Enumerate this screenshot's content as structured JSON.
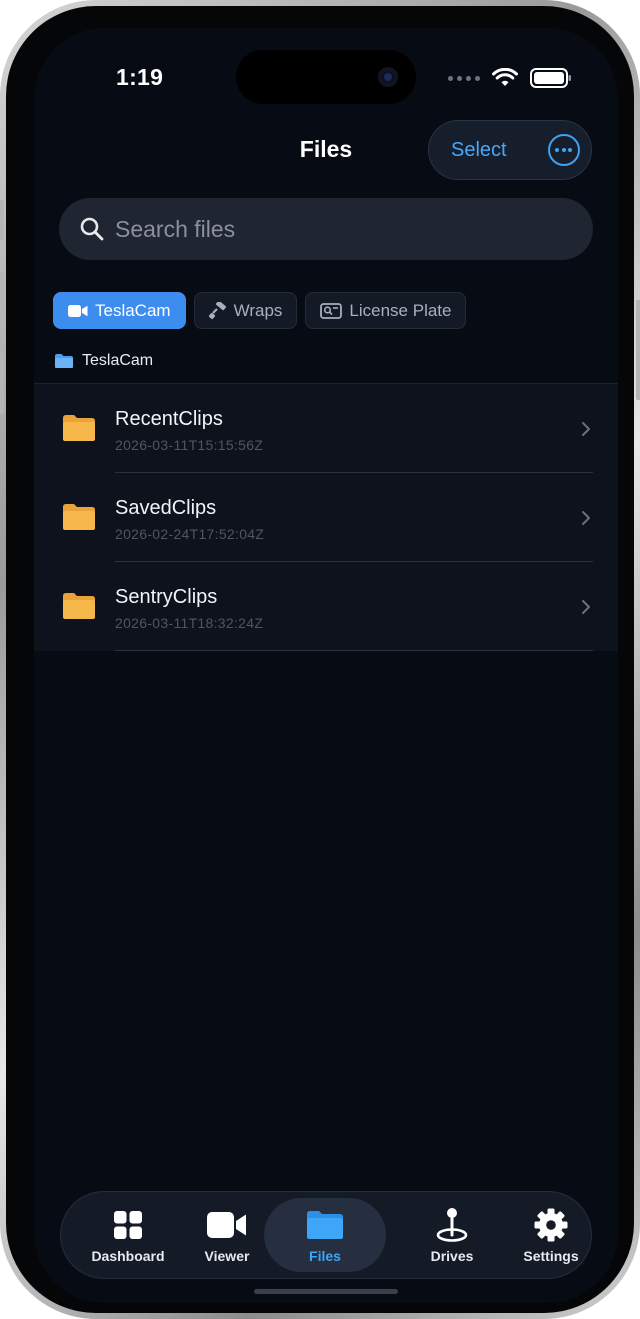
{
  "status": {
    "time": "1:19"
  },
  "nav": {
    "title": "Files",
    "select_label": "Select"
  },
  "search": {
    "placeholder": "Search files"
  },
  "chips": [
    {
      "label": "TeslaCam",
      "icon": "video-icon",
      "active": true
    },
    {
      "label": "Wraps",
      "icon": "paint-roller-icon",
      "active": false
    },
    {
      "label": "License Plate",
      "icon": "license-plate-icon",
      "active": false
    }
  ],
  "breadcrumb": {
    "label": "TeslaCam"
  },
  "folders": [
    {
      "name": "RecentClips",
      "date": "2026-03-11T15:15:56Z"
    },
    {
      "name": "SavedClips",
      "date": "2026-02-24T17:52:04Z"
    },
    {
      "name": "SentryClips",
      "date": "2026-03-11T18:32:24Z"
    }
  ],
  "tabs": [
    {
      "label": "Dashboard",
      "icon": "grid-icon",
      "active": false
    },
    {
      "label": "Viewer",
      "icon": "video-icon",
      "active": false
    },
    {
      "label": "Files",
      "icon": "folder-icon",
      "active": true
    },
    {
      "label": "Drives",
      "icon": "map-pin-icon",
      "active": false
    },
    {
      "label": "Settings",
      "icon": "gear-icon",
      "active": false
    }
  ],
  "colors": {
    "accent": "#3d8df0",
    "folder": "#f6b84b",
    "background": "#070b14"
  }
}
